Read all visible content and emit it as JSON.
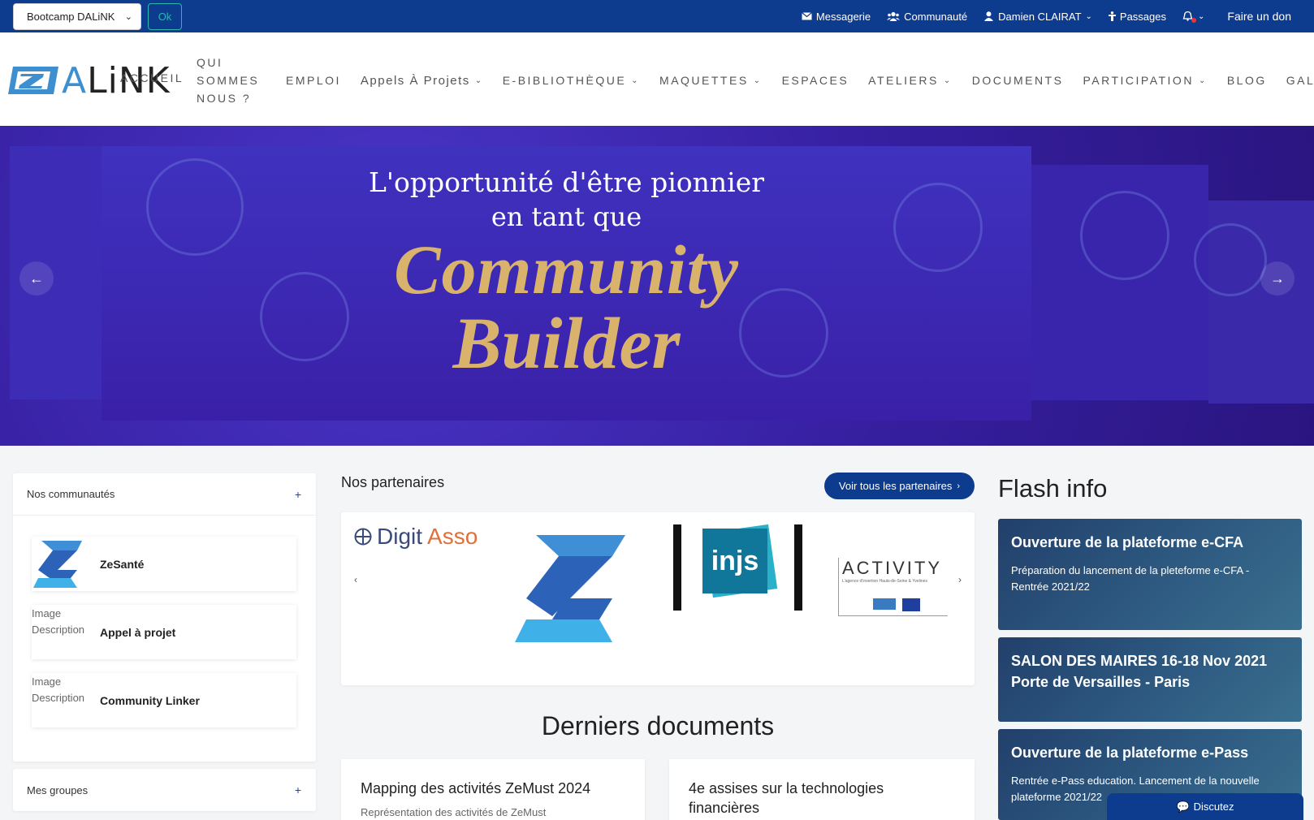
{
  "topbar": {
    "community_select": "Bootcamp DALiNK",
    "ok_label": "Ok",
    "links": {
      "messagerie": "Messagerie",
      "communaute": "Communauté",
      "user": "Damien CLAIRAT",
      "passages": "Passages",
      "donate": "Faire un don"
    }
  },
  "logo": {
    "text_a": "A",
    "text_rest": "LiNK"
  },
  "nav": {
    "accueil": "ACCUEIL",
    "qui": "QUI SOMMES NOUS ?",
    "emploi": "EMPLOI",
    "appels": "Appels À Projets",
    "ebiblio": "E-BIBLIOTHÈQUE",
    "maquettes": "MAQUETTES",
    "espaces": "ESPACES",
    "ateliers": "ATELIERS",
    "documents": "DOCUMENTS",
    "participation": "PARTICIPATION",
    "blog": "BLOG",
    "galeries": "GALERIES"
  },
  "hero": {
    "line1": "L'opportunité d'être pionnier",
    "line2": "en tant que",
    "line3": "Community",
    "line4": "Builder"
  },
  "communities": {
    "title": "Nos communautés",
    "items": [
      {
        "name": "ZeSanté",
        "thumb": ""
      },
      {
        "name": "Appel à projet",
        "thumb": "Image Description"
      },
      {
        "name": "Community Linker",
        "thumb": "Image Description"
      }
    ]
  },
  "groups": {
    "title": "Mes groupes"
  },
  "partners": {
    "title": "Nos partenaires",
    "button": "Voir tous les partenaires",
    "logos": {
      "digit": "Digit",
      "asso": "Asso",
      "injs": "injs",
      "activity": "ACTIVITY",
      "activity_sub": "L'agence d'insertion Hauts-de-Seine & Yvelines"
    }
  },
  "documents": {
    "title": "Derniers documents",
    "items": [
      {
        "title": "Mapping des activités ZeMust 2024",
        "subtitle": "Représentation des activités de ZeMust"
      },
      {
        "title": "4e assises sur la technologies financières",
        "subtitle": ""
      }
    ]
  },
  "flash": {
    "title": "Flash info",
    "items": [
      {
        "title": "Ouverture de la plateforme e-CFA",
        "text": "Préparation du lancement de la pleteforme e-CFA - Rentrée 2021/22"
      },
      {
        "title": "SALON DES MAIRES 16-18 Nov 2021 Porte de Versailles - Paris",
        "text": ""
      },
      {
        "title": "Ouverture de la plateforme e-Pass",
        "text": "Rentrée e-Pass education. Lancement de la nouvelle plateforme 2021/22"
      }
    ]
  },
  "chat": {
    "label": "Discutez"
  },
  "colors": {
    "primary": "#0d3b8e",
    "accent": "#2ab7b1",
    "hero": "#3b1fa6",
    "gold": "#d9b36c"
  }
}
